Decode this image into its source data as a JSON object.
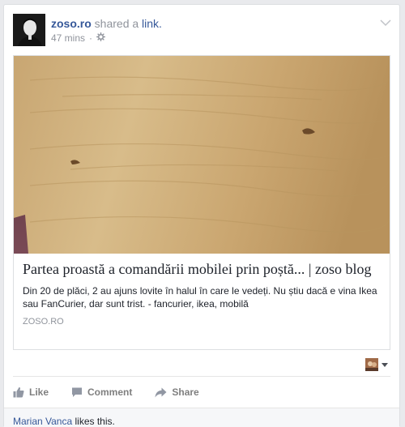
{
  "post": {
    "author": "zoso.ro",
    "verb": "shared a",
    "object": "link.",
    "time": "47 mins",
    "separator": "·",
    "privacy_icon": "gear-icon"
  },
  "attachment": {
    "title": "Partea proastă a comandării mobilei prin poștă... | zoso blog",
    "description": "Din 20 de plăci, 2 au ajuns lovite în halul în care le vedeți. Nu știu dacă e vina Ikea sau FanCurier, dar sunt trist. - fancurier, ikea, mobilă",
    "domain": "ZOSO.RO"
  },
  "actions": {
    "like": "Like",
    "comment": "Comment",
    "share": "Share"
  },
  "likes": {
    "name": "Marian Vanca",
    "text": "likes this."
  },
  "colors": {
    "link": "#365899",
    "muted": "#90949c",
    "text": "#1d2129",
    "background": "#e9eaed"
  }
}
